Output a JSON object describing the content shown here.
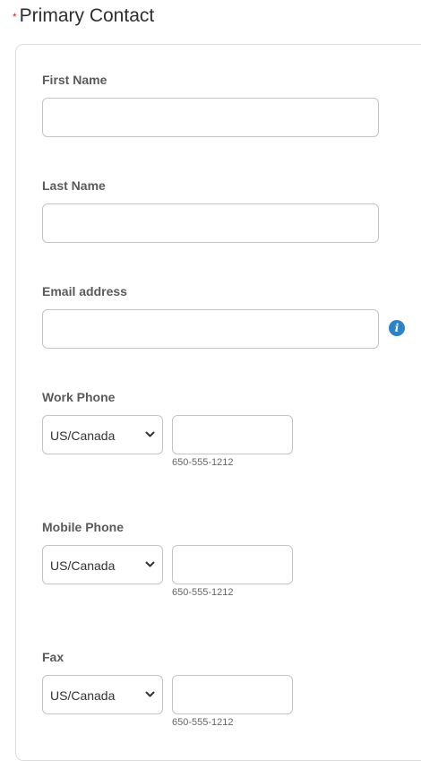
{
  "section": {
    "required_marker": "*",
    "title": "Primary Contact"
  },
  "fields": {
    "first_name": {
      "label": "First Name",
      "value": ""
    },
    "last_name": {
      "label": "Last Name",
      "value": ""
    },
    "email": {
      "label": "Email address",
      "value": "",
      "info_icon": "i"
    }
  },
  "phones": {
    "work": {
      "label": "Work Phone",
      "country": "US/Canada",
      "number": "",
      "hint": "650-555-1212"
    },
    "mobile": {
      "label": "Mobile Phone",
      "country": "US/Canada",
      "number": "",
      "hint": "650-555-1212"
    },
    "fax": {
      "label": "Fax",
      "country": "US/Canada",
      "number": "",
      "hint": "650-555-1212"
    }
  },
  "colors": {
    "required": "#d22f27",
    "info_icon": "#2b83c6",
    "border": "#c4c4c4"
  },
  "icons": {
    "info": "info-icon",
    "dropdown": "chevron-down-icon"
  }
}
